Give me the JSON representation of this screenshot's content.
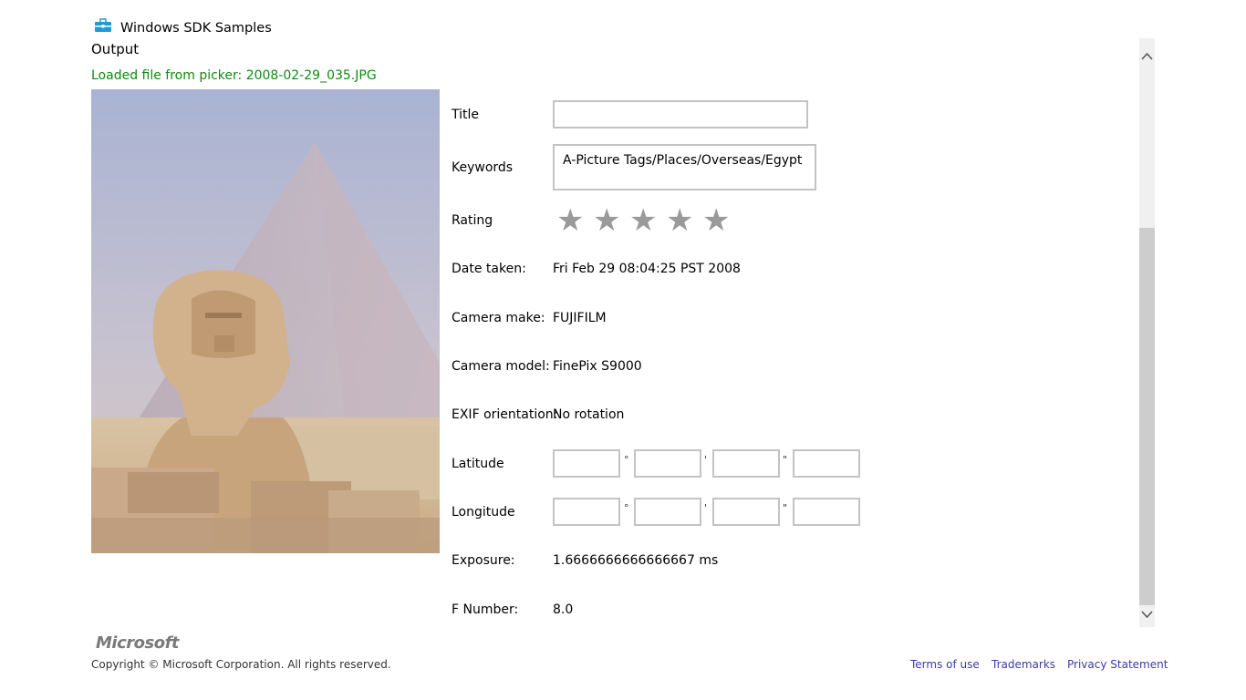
{
  "header": {
    "app_title": "Windows SDK Samples",
    "section_title": "Output",
    "status_message": "Loaded file from picker: 2008-02-29_035.JPG",
    "status_color": "#108a10",
    "app_icon": "toolbox-icon"
  },
  "properties": {
    "title_label": "Title",
    "title_value": "",
    "keywords_label": "Keywords",
    "keywords_value": "A-Picture Tags/Places/Overseas/Egypt",
    "rating_label": "Rating",
    "rating_value": 0,
    "rating_max": 5,
    "rating_star_glyph": "★",
    "date_taken_label": "Date taken:",
    "date_taken_value": "Fri Feb 29 08:04:25 PST 2008",
    "camera_make_label": "Camera make:",
    "camera_make_value": "FUJIFILM",
    "camera_model_label": "Camera model:",
    "camera_model_value": "FinePix S9000",
    "exif_orientation_label": "EXIF orientation:",
    "exif_orientation_value": "No rotation",
    "latitude_label": "Latitude",
    "longitude_label": "Longitude",
    "coord_symbols": [
      "°",
      "'",
      "\""
    ],
    "exposure_label": "Exposure:",
    "exposure_value": "1.6666666666666667 ms",
    "fnumber_label": "F Number:",
    "fnumber_value": "8.0"
  },
  "scrollbar": {
    "up_icon": "▲",
    "down_icon": "▼"
  },
  "footer": {
    "logo_text": "Microsoft",
    "copyright": "Copyright © Microsoft Corporation. All rights reserved.",
    "links": [
      "Terms of use",
      "Trademarks",
      "Privacy Statement"
    ],
    "link_color": "#3b3ba3"
  }
}
